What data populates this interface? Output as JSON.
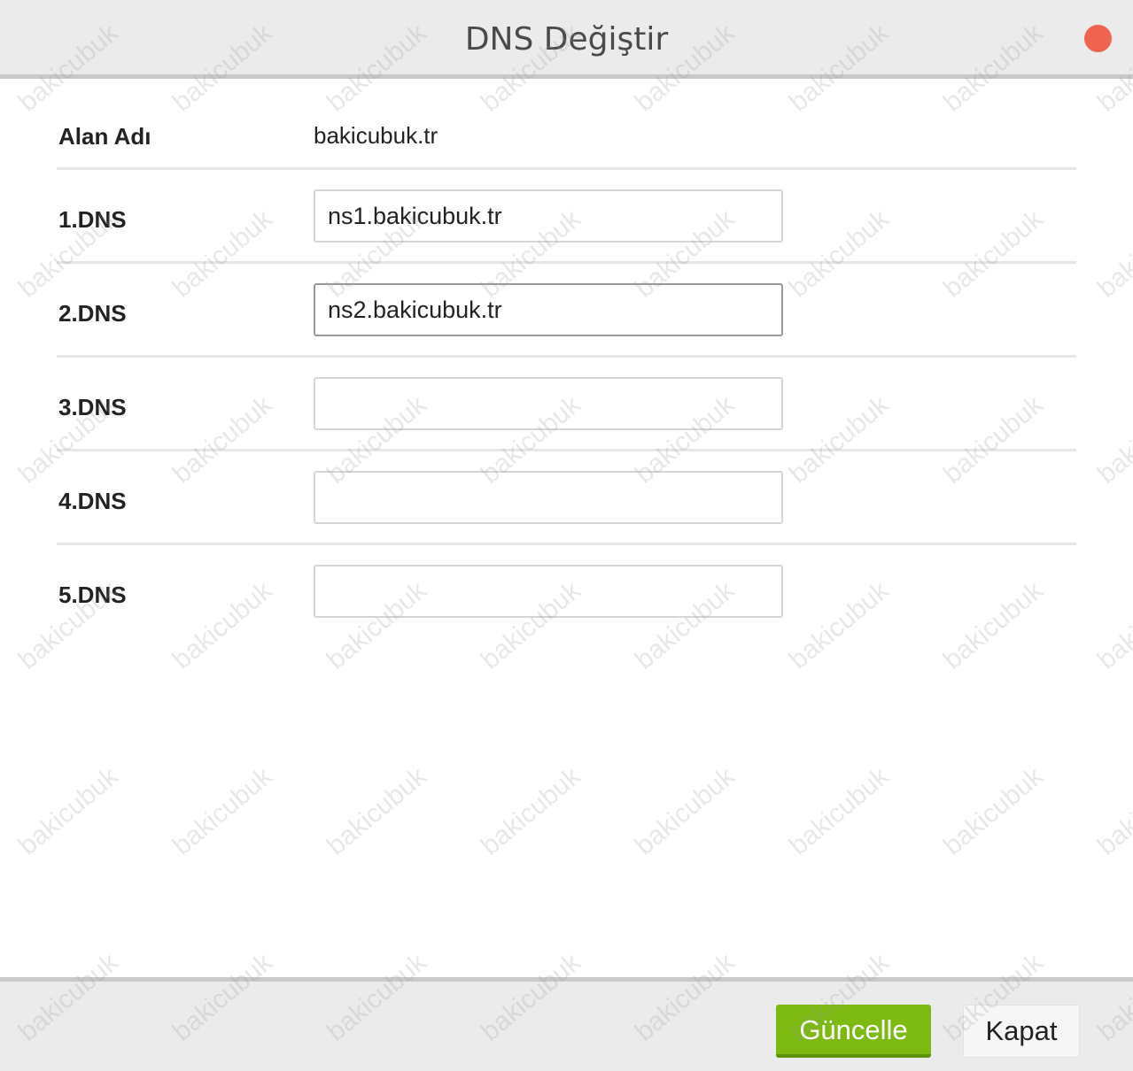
{
  "dialog": {
    "title": "DNS Değiştir",
    "close_color": "#ee6450"
  },
  "domain": {
    "label": "Alan Adı",
    "value": "bakicubuk.tr"
  },
  "dns": [
    {
      "label": "1.DNS",
      "value": "ns1.bakicubuk.tr"
    },
    {
      "label": "2.DNS",
      "value": "ns2.bakicubuk.tr"
    },
    {
      "label": "3.DNS",
      "value": ""
    },
    {
      "label": "4.DNS",
      "value": ""
    },
    {
      "label": "5.DNS",
      "value": ""
    }
  ],
  "footer": {
    "update_label": "Güncelle",
    "close_label": "Kapat",
    "update_color": "#7cba12"
  },
  "watermark": {
    "text": "bakicubuk"
  }
}
